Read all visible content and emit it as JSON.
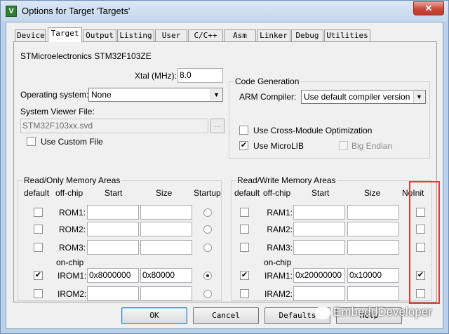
{
  "window": {
    "title": "Options for Target 'Targets'",
    "close_glyph": "✕",
    "app_icon_glyph": "V"
  },
  "tabs": [
    "Device",
    "Target",
    "Output",
    "Listing",
    "User",
    "C/C++",
    "Asm",
    "Linker",
    "Debug",
    "Utilities"
  ],
  "active_tab": "Target",
  "target": {
    "device_name": "STMicroelectronics STM32F103ZE",
    "xtal_label": "Xtal (MHz):",
    "xtal_value": "8.0",
    "os_label": "Operating system:",
    "os_value": "None",
    "svf_label": "System Viewer File:",
    "svf_value": "STM32F103xx.svd",
    "browse_label": "...",
    "custom_file_label": "Use Custom File",
    "custom_file_checked": false
  },
  "code_generation": {
    "title": "Code Generation",
    "compiler_label": "ARM Compiler:",
    "compiler_value": "Use default compiler version",
    "cross_module_label": "Use Cross-Module Optimization",
    "cross_module_checked": false,
    "microlib_label": "Use MicroLIB",
    "microlib_checked": true,
    "big_endian_label": "Big Endian",
    "big_endian_checked": false
  },
  "ro_memory": {
    "title": "Read/Only Memory Areas",
    "headers": {
      "default": "default",
      "offchip": "off-chip",
      "start": "Start",
      "size": "Size",
      "startup": "Startup"
    },
    "onchip_label": "on-chip",
    "rows": [
      {
        "label": "ROM1:",
        "default": false,
        "start": "",
        "size": "",
        "startup": false
      },
      {
        "label": "ROM2:",
        "default": false,
        "start": "",
        "size": "",
        "startup": false
      },
      {
        "label": "ROM3:",
        "default": false,
        "start": "",
        "size": "",
        "startup": false
      },
      {
        "label": "IROM1:",
        "default": true,
        "start": "0x8000000",
        "size": "0x80000",
        "startup": true
      },
      {
        "label": "IROM2:",
        "default": false,
        "start": "",
        "size": "",
        "startup": false
      }
    ]
  },
  "rw_memory": {
    "title": "Read/Write Memory Areas",
    "headers": {
      "default": "default",
      "offchip": "off-chip",
      "start": "Start",
      "size": "Size",
      "noinit": "NoInit"
    },
    "onchip_label": "on-chip",
    "rows": [
      {
        "label": "RAM1:",
        "default": false,
        "start": "",
        "size": "",
        "noinit": false
      },
      {
        "label": "RAM2:",
        "default": false,
        "start": "",
        "size": "",
        "noinit": false
      },
      {
        "label": "RAM3:",
        "default": false,
        "start": "",
        "size": "",
        "noinit": false
      },
      {
        "label": "IRAM1:",
        "default": true,
        "start": "0x20000000",
        "size": "0x10000",
        "noinit": true
      },
      {
        "label": "IRAM2:",
        "default": false,
        "start": "",
        "size": "",
        "noinit": false
      }
    ]
  },
  "buttons": {
    "ok": "OK",
    "cancel": "Cancel",
    "defaults": "Defaults",
    "help": "Help"
  },
  "watermark": "EmbeddDeveloper",
  "check_glyph": "✔",
  "colors": {
    "highlight": "#e53935",
    "title_bar": "#c3d7ec",
    "close": "#c0392b"
  }
}
